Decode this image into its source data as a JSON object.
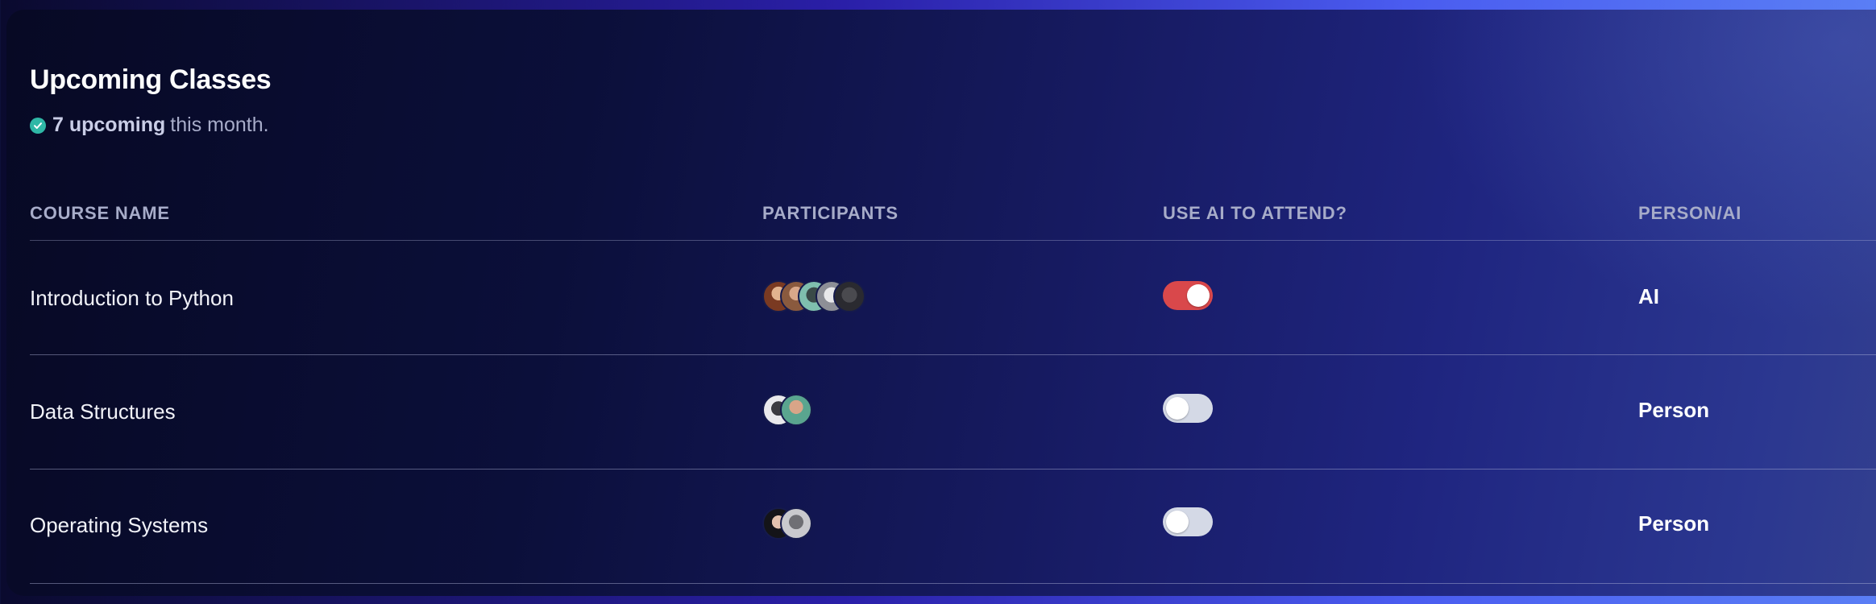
{
  "card": {
    "title": "Upcoming Classes",
    "summary": {
      "count_text": "7 upcoming",
      "suffix_text": "this month."
    }
  },
  "table": {
    "headers": {
      "course": "COURSE NAME",
      "participants": "PARTICIPANTS",
      "use_ai": "USE AI TO ATTEND?",
      "mode": "PERSON/AI"
    },
    "rows": [
      {
        "course": "Introduction to Python",
        "participant_count": 5,
        "use_ai": true,
        "mode": "AI"
      },
      {
        "course": "Data Structures",
        "participant_count": 2,
        "use_ai": false,
        "mode": "Person"
      },
      {
        "course": "Operating Systems",
        "participant_count": 2,
        "use_ai": false,
        "mode": "Person"
      }
    ]
  },
  "colors": {
    "toggle_on": "#d9484b",
    "toggle_off": "#d4d9e6",
    "check_badge": "#2fb7a6"
  },
  "icons": {
    "summary": "check-circle-icon"
  }
}
